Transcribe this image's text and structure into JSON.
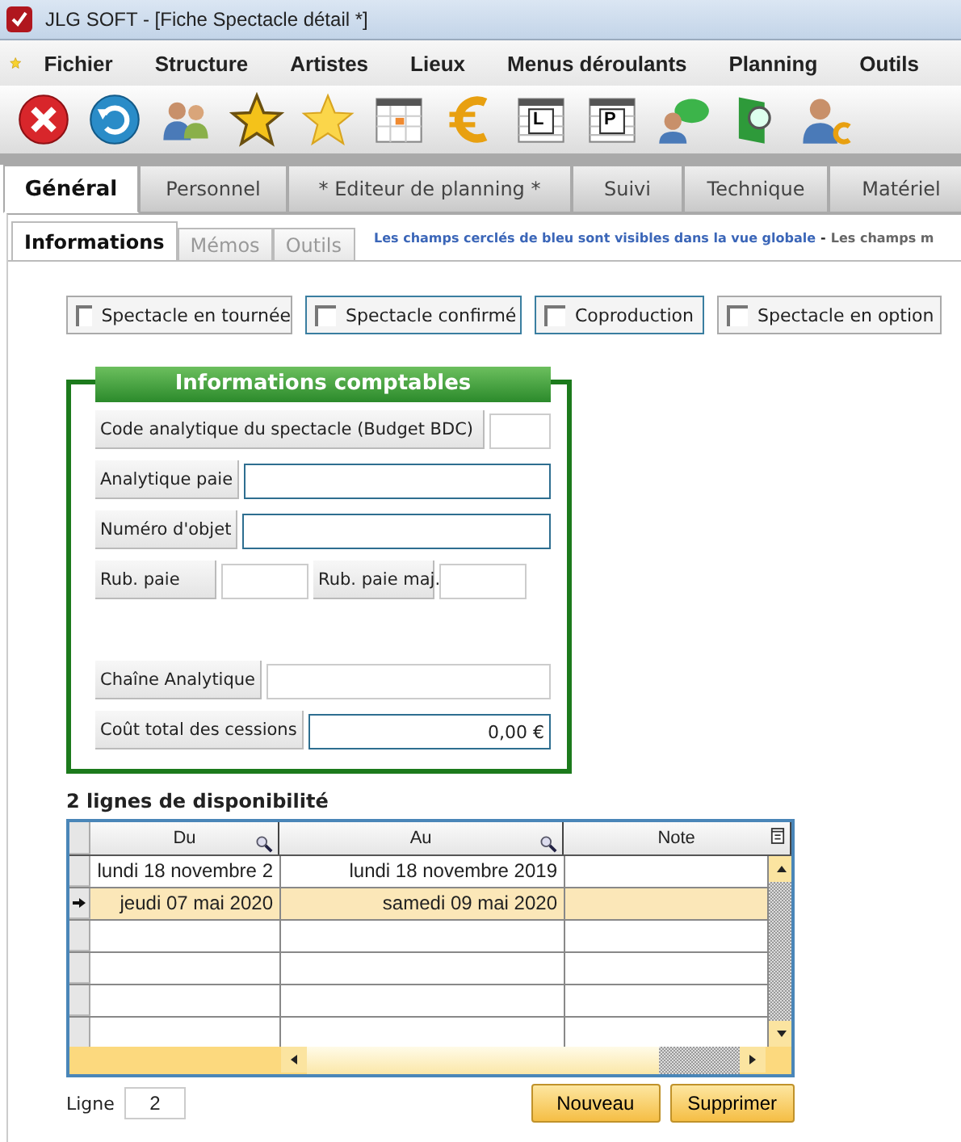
{
  "window": {
    "title": "JLG SOFT - [Fiche Spectacle détail *]"
  },
  "menu": [
    "Fichier",
    "Structure",
    "Artistes",
    "Lieux",
    "Menus déroulants",
    "Planning",
    "Outils"
  ],
  "toolbar": [
    {
      "kind": "cancel"
    },
    {
      "kind": "refresh"
    },
    {
      "kind": "people"
    },
    {
      "kind": "star-outline"
    },
    {
      "kind": "star"
    },
    {
      "kind": "calendar"
    },
    {
      "kind": "euro"
    },
    {
      "kind": "calendar-letter",
      "letter": "L"
    },
    {
      "kind": "calendar-letter",
      "letter": "P"
    },
    {
      "kind": "chat"
    },
    {
      "kind": "book"
    },
    {
      "kind": "person-euro"
    }
  ],
  "tabs": [
    {
      "label": "Général",
      "selected": true
    },
    {
      "label": "Personnel",
      "selected": false
    },
    {
      "label": "* Editeur de planning *",
      "selected": false
    },
    {
      "label": "Suivi",
      "selected": false
    },
    {
      "label": "Technique",
      "selected": false
    },
    {
      "label": "Matériel",
      "selected": false
    }
  ],
  "subtabs": [
    {
      "label": "Informations",
      "selected": true
    },
    {
      "label": "Mémos",
      "selected": false
    },
    {
      "label": "Outils",
      "selected": false
    }
  ],
  "notice": {
    "highlight": "Les champs cerclés de bleu sont visibles dans la vue globale",
    "separator": "-",
    "rest": "Les champs m"
  },
  "options": [
    {
      "label": "Spectacle en tournée",
      "checked": false,
      "highlighted": false
    },
    {
      "label": "Spectacle confirmé",
      "checked": false,
      "highlighted": true
    },
    {
      "label": "Coproduction",
      "checked": false,
      "highlighted": true
    },
    {
      "label": "Spectacle en option",
      "checked": false,
      "highlighted": false
    }
  ],
  "accounting": {
    "title": "Informations comptables",
    "rows": [
      {
        "kind": "short",
        "fields": [
          {
            "label": "Code analytique du spectacle (Budget BDC)",
            "highlighted": false
          }
        ]
      },
      {
        "kind": "wide",
        "fields": [
          {
            "label": "Analytique paie",
            "highlighted": true
          }
        ]
      },
      {
        "kind": "wide",
        "fields": [
          {
            "label": "Numéro d'objet",
            "highlighted": true
          }
        ]
      },
      {
        "kind": "pair",
        "fields": [
          {
            "label": "Rub. paie",
            "highlighted": false
          },
          {
            "label": "Rub. paie maj.",
            "highlighted": false
          }
        ]
      },
      {
        "kind": "wide",
        "fields": [
          {
            "label": "Chaîne Analytique",
            "highlighted": false
          }
        ]
      },
      {
        "kind": "wide",
        "fields": [
          {
            "label": "Coût total des cessions",
            "value": "0,00 €",
            "highlighted": true
          }
        ]
      }
    ]
  },
  "availability": {
    "title": "2 lignes de disponibilité",
    "columns": [
      {
        "label": "Du"
      },
      {
        "label": "Au"
      },
      {
        "label": "Note"
      }
    ],
    "rows": [
      {
        "cells": [
          "lundi 18 novembre 2",
          "lundi 18 novembre 2019",
          ""
        ],
        "selected": false
      },
      {
        "cells": [
          "jeudi 07 mai 2020",
          "samedi 09 mai 2020",
          ""
        ],
        "selected": true
      }
    ]
  },
  "footer": {
    "line_label": "Ligne",
    "line_value": "2",
    "buttons": [
      "Nouveau",
      "Supprimer"
    ]
  }
}
